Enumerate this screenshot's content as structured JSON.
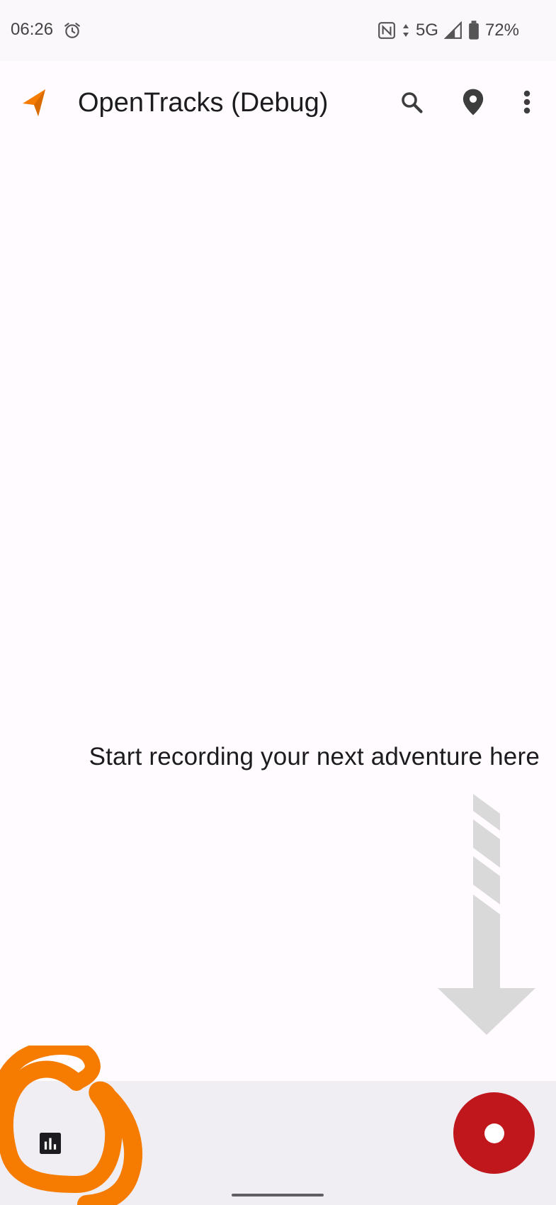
{
  "status_bar": {
    "time": "06:26",
    "network": "5G",
    "battery": "72%",
    "icons": [
      "alarm-icon",
      "nfc-icon",
      "data-arrows-icon",
      "signal-icon",
      "battery-icon"
    ]
  },
  "app_bar": {
    "title": "OpenTracks (Debug)",
    "logo_icon": "navigation-arrow-logo",
    "actions": [
      "search-icon",
      "location-pin-icon",
      "more-vert-icon"
    ]
  },
  "empty_state": {
    "message": "Start recording your next adventure here"
  },
  "bottom_bar": {
    "left_icon": "bar-chart-icon",
    "fab_icon": "record-icon"
  },
  "colors": {
    "accent": "#f57c00",
    "record": "#c0171d",
    "background": "#fffbfe",
    "bottom_bar": "#f1eef3",
    "arrow_hint": "#d9d9d9",
    "annotation": "#f57c00"
  }
}
